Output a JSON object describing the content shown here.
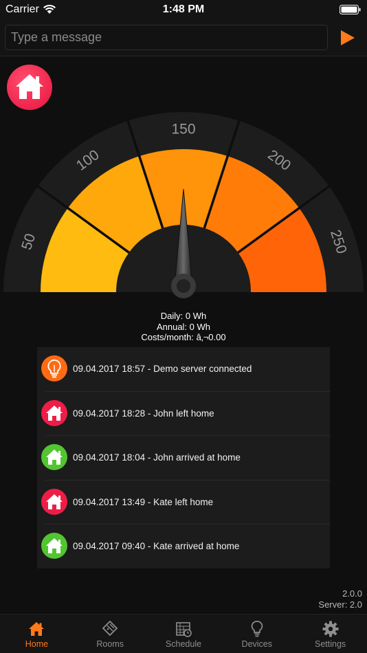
{
  "status": {
    "carrier": "Carrier",
    "time": "1:48 PM"
  },
  "message": {
    "placeholder": "Type a message"
  },
  "gauge": {
    "labels": [
      "50",
      "100",
      "150",
      "200",
      "250"
    ],
    "needle_value": 150,
    "colors": [
      "#ffbb10",
      "#ffa80c",
      "#ff9309",
      "#ff7c08",
      "#ff6508"
    ]
  },
  "readouts": {
    "daily": "Daily: 0 Wh",
    "annual": "Annual: 0 Wh",
    "costs": "Costs/month: â‚¬0.00"
  },
  "events": [
    {
      "text": "09.04.2017 18:57 - Demo server connected",
      "icon": "bulb-icon",
      "color": "#ff6b14"
    },
    {
      "text": "09.04.2017 18:28 - John left home",
      "icon": "home-icon",
      "color": "#ee1d48"
    },
    {
      "text": "09.04.2017 18:04 - John arrived at home",
      "icon": "home-icon",
      "color": "#52c531"
    },
    {
      "text": "09.04.2017 13:49 - Kate left home",
      "icon": "home-icon",
      "color": "#ee1d48"
    },
    {
      "text": "09.04.2017 09:40 - Kate arrived at home",
      "icon": "home-icon",
      "color": "#52c531"
    }
  ],
  "version": {
    "app": "2.0.0",
    "server": "Server: 2.0"
  },
  "tabs": [
    {
      "label": "Home",
      "icon": "home-icon",
      "active": true
    },
    {
      "label": "Rooms",
      "icon": "rooms-icon",
      "active": false
    },
    {
      "label": "Schedule",
      "icon": "schedule-icon",
      "active": false
    },
    {
      "label": "Devices",
      "icon": "bulb-icon",
      "active": false
    },
    {
      "label": "Settings",
      "icon": "gear-icon",
      "active": false
    }
  ],
  "accent": "#ff7a1a"
}
